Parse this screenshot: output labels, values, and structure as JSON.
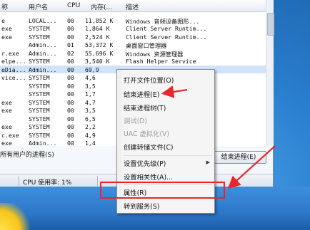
{
  "columns": {
    "name": "称",
    "user": "用户名",
    "cpu": "CPU",
    "mem": "内存(...",
    "desc": "描述"
  },
  "rows": [
    {
      "name": "",
      "user": "",
      "cpu": "",
      "mem": "",
      "desc": ""
    },
    {
      "name": "e",
      "user": "LOCAL...",
      "cpu": "00",
      "mem": "11,852 K",
      "desc": "Windows 音频设备图形..."
    },
    {
      "name": "exe",
      "user": "SYSTEM",
      "cpu": "00",
      "mem": "1,864 K",
      "desc": "Client Server Runtim..."
    },
    {
      "name": "exe",
      "user": "SYSTEM",
      "cpu": "00",
      "mem": "2,524 K",
      "desc": "Client Server Runtim..."
    },
    {
      "name": "",
      "user": "Admin...",
      "cpu": "01",
      "mem": "53,372 K",
      "desc": "桌面窗口管理器"
    },
    {
      "name": "r.exe",
      "user": "Admin...",
      "cpu": "02",
      "mem": "55,696 K",
      "desc": "Windows 资源管理器"
    },
    {
      "name": "elpe...",
      "user": "SYSTEM",
      "cpu": "00",
      "mem": "3,540 K",
      "desc": "Flash Helper Service"
    },
    {
      "name": "eDia...",
      "user": "Admin...",
      "cpu": "00",
      "mem": "69,9",
      "desc": ""
    },
    {
      "name": "vice...",
      "user": "SYSTEM",
      "cpu": "00",
      "mem": "4,6",
      "desc": ""
    },
    {
      "name": "",
      "user": "SYSTEM",
      "cpu": "00",
      "mem": "3,5",
      "desc": ""
    },
    {
      "name": "",
      "user": "SYSTEM",
      "cpu": "00",
      "mem": "1,7",
      "desc": ""
    },
    {
      "name": "exe",
      "user": "SYSTEM",
      "cpu": "00",
      "mem": "4,7",
      "desc": ""
    },
    {
      "name": "exe",
      "user": "SYSTEM",
      "cpu": "00",
      "mem": "3,5",
      "desc": ""
    },
    {
      "name": "",
      "user": "SYSTEM",
      "cpu": "00",
      "mem": "6,5",
      "desc": ""
    },
    {
      "name": "exe",
      "user": "SYSTEM",
      "cpu": "00",
      "mem": "2,2",
      "desc": ""
    },
    {
      "name": "c.exe",
      "user": "SYSTEM",
      "cpu": "00",
      "mem": "4,9",
      "desc": ""
    },
    {
      "name": "exe",
      "user": "Admin...",
      "cpu": "00",
      "mem": "1,4",
      "desc": ""
    },
    {
      "name": "",
      "user": "",
      "cpu": "",
      "mem": "",
      "desc": ""
    }
  ],
  "show_all_label": "所有用户的进程(S)",
  "end_process_button": "结束进程(E)",
  "status": {
    "cpu": "CPU 使用率: 1%"
  },
  "context_menu": [
    {
      "label": "打开文件位置(O)",
      "disabled": false
    },
    {
      "label": "结束进程(E)",
      "disabled": false
    },
    {
      "label": "结束进程树(T)",
      "disabled": false
    },
    {
      "label": "调试(D)",
      "disabled": true
    },
    {
      "label": "UAC 虚拟化(V)",
      "disabled": true
    },
    {
      "label": "创建转储文件(C)",
      "disabled": false
    },
    {
      "label": "设置优先级(P)",
      "disabled": false,
      "submenu": true
    },
    {
      "label": "设置相关性(A)...",
      "disabled": false
    },
    {
      "label": "属性(R)",
      "disabled": false
    },
    {
      "label": "转到服务(S)",
      "disabled": false
    }
  ],
  "colors": {
    "annotation": "#e8262b"
  }
}
